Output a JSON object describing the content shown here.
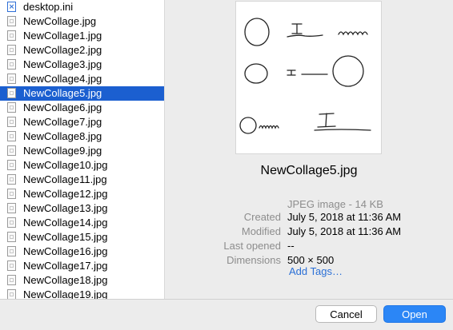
{
  "files": [
    {
      "name": "desktop.ini",
      "icon": "ini-file-icon",
      "selected": false
    },
    {
      "name": "NewCollage.jpg",
      "icon": "image-file-icon",
      "selected": false
    },
    {
      "name": "NewCollage1.jpg",
      "icon": "image-file-icon",
      "selected": false
    },
    {
      "name": "NewCollage2.jpg",
      "icon": "image-file-icon",
      "selected": false
    },
    {
      "name": "NewCollage3.jpg",
      "icon": "image-file-icon",
      "selected": false
    },
    {
      "name": "NewCollage4.jpg",
      "icon": "image-file-icon",
      "selected": false
    },
    {
      "name": "NewCollage5.jpg",
      "icon": "image-file-icon",
      "selected": true
    },
    {
      "name": "NewCollage6.jpg",
      "icon": "image-file-icon",
      "selected": false
    },
    {
      "name": "NewCollage7.jpg",
      "icon": "image-file-icon",
      "selected": false
    },
    {
      "name": "NewCollage8.jpg",
      "icon": "image-file-icon",
      "selected": false
    },
    {
      "name": "NewCollage9.jpg",
      "icon": "image-file-icon",
      "selected": false
    },
    {
      "name": "NewCollage10.jpg",
      "icon": "image-file-icon",
      "selected": false
    },
    {
      "name": "NewCollage11.jpg",
      "icon": "image-file-icon",
      "selected": false
    },
    {
      "name": "NewCollage12.jpg",
      "icon": "image-file-icon",
      "selected": false
    },
    {
      "name": "NewCollage13.jpg",
      "icon": "image-file-icon",
      "selected": false
    },
    {
      "name": "NewCollage14.jpg",
      "icon": "image-file-icon",
      "selected": false
    },
    {
      "name": "NewCollage15.jpg",
      "icon": "image-file-icon",
      "selected": false
    },
    {
      "name": "NewCollage16.jpg",
      "icon": "image-file-icon",
      "selected": false
    },
    {
      "name": "NewCollage17.jpg",
      "icon": "image-file-icon",
      "selected": false
    },
    {
      "name": "NewCollage18.jpg",
      "icon": "image-file-icon",
      "selected": false
    },
    {
      "name": "NewCollage19.jpg",
      "icon": "image-file-icon",
      "selected": false
    }
  ],
  "preview": {
    "filename": "NewCollage5.jpg",
    "kind": "JPEG image - 14 KB",
    "info": [
      {
        "label": "Created",
        "value": "July 5, 2018 at 11:36 AM"
      },
      {
        "label": "Modified",
        "value": "July 5, 2018 at 11:36 AM"
      },
      {
        "label": "Last opened",
        "value": "--"
      },
      {
        "label": "Dimensions",
        "value": "500 × 500"
      }
    ],
    "add_tags": "Add Tags…"
  },
  "buttons": {
    "cancel": "Cancel",
    "open": "Open"
  },
  "colors": {
    "selection": "#1b5fd0",
    "primary_button": "#2b86f6",
    "link": "#2a6fd6"
  }
}
